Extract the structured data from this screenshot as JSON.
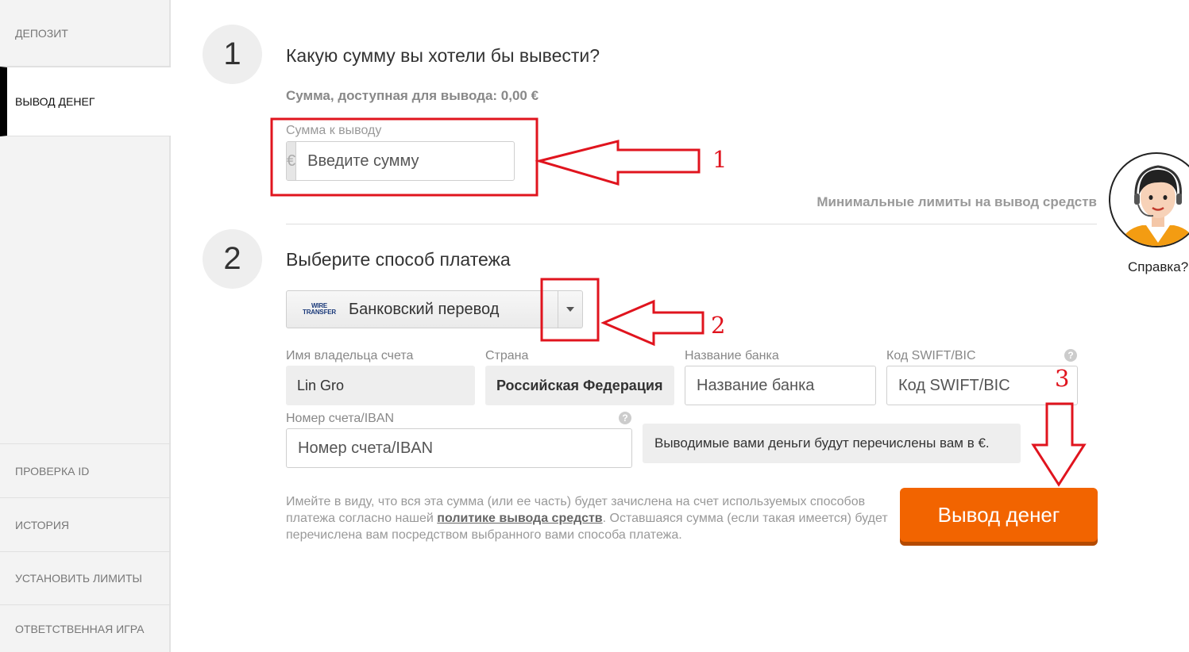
{
  "sidebar": {
    "items": [
      {
        "label": "ДЕПОЗИТ"
      },
      {
        "label": "ВЫВОД ДЕНЕГ"
      },
      {
        "label": "ПРОВЕРКА ID"
      },
      {
        "label": "ИСТОРИЯ"
      },
      {
        "label": "УСТАНОВИТЬ ЛИМИТЫ"
      },
      {
        "label": "ОТВЕТСТВЕННАЯ ИГРА"
      }
    ],
    "active_index": 1
  },
  "step1": {
    "number": "1",
    "title": "Какую сумму вы хотели бы вывести?",
    "available_text": "Сумма, доступная для вывода: 0,00 €",
    "amount_label": "Сумма к выводу",
    "currency_symbol": "€",
    "amount_placeholder": "Введите сумму",
    "amount_value": "",
    "min_limits_link": "Минимальные лимиты на вывод средств"
  },
  "step2": {
    "number": "2",
    "title": "Выберите способ платежа",
    "method_logo_line1": "WIRE",
    "method_logo_line2": "TRANSFER",
    "method_selected": "Банковский перевод",
    "fields": {
      "holder_label": "Имя владельца счета",
      "holder_value": "Lin Gro",
      "country_label": "Страна",
      "country_value": "Российская Федерация",
      "bank_label": "Название банка",
      "bank_placeholder": "Название банка",
      "swift_label": "Код SWIFT/BIC",
      "swift_placeholder": "Код SWIFT/BIC",
      "iban_label": "Номер счета/IBAN",
      "iban_placeholder": "Номер счета/IBAN",
      "help_glyph": "?"
    },
    "currency_notice": "Выводимые вами деньги будут перечислены вам в €."
  },
  "disclaimer": {
    "part1": "Имейте в виду, что вся эта сумма (или ее часть) будет зачислена на счет используемых способов платежа согласно нашей ",
    "link": "политике вывода средств",
    "part2": ". Оставшаяся сумма (если такая имеется) будет перечислена вам посредством выбранного вами способа платежа."
  },
  "withdraw_button": "Вывод денег",
  "help_widget": {
    "label": "Справка?"
  },
  "annotations": {
    "n1": "1",
    "n2": "2",
    "n3": "3",
    "color": "#e0141e"
  },
  "colors": {
    "accent": "#f26400",
    "sidebar_bg": "#f3f3f3",
    "annotation": "#e0141e"
  }
}
